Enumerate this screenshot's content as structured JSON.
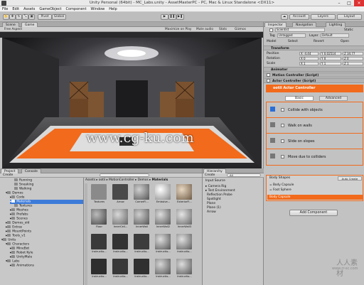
{
  "window": {
    "title": "Unity Personal (64bit) - MC_Labs.unity - AssetMasterPC - PC, Mac & Linux Standalone <DX11>"
  },
  "menu": [
    "File",
    "Edit",
    "Assets",
    "GameObject",
    "Component",
    "Window",
    "Help"
  ],
  "toolbar": {
    "pivot": "Pivot",
    "global": "Global",
    "account": "Account",
    "layers": "Layers",
    "layout": "Layout"
  },
  "game_tabs": {
    "scene": "Scene",
    "game": "Game"
  },
  "gamebar": {
    "aspect": "Free Aspect",
    "maximize": "Maximize on Play",
    "mute": "Mute audio",
    "stats": "Stats",
    "gizmos": "Gizmos"
  },
  "watermark": {
    "main": "www.cg-ku.com",
    "corner": "人人素材",
    "corner_url": "www.rr-sc.com"
  },
  "inspector": {
    "tabs": [
      "Inspector",
      "Navigation",
      "Lighting"
    ],
    "object_name": "Scientist",
    "static": "Static",
    "tag_label": "Tag",
    "tag_value": "Untagged",
    "layer_label": "Layer",
    "layer_value": "Default",
    "prefab": {
      "model": "Model",
      "select": "Select",
      "revert": "Revert",
      "open": "Open"
    },
    "transform": {
      "title": "Transform",
      "position": {
        "label": "Position",
        "x": "X -4.44",
        "y": "Y 0.02514",
        "z": "Z 34.77"
      },
      "rotation": {
        "label": "Rotation",
        "x": "X 0",
        "y": "Y 0",
        "z": "Z 0"
      },
      "scale": {
        "label": "Scale",
        "x": "X 1",
        "y": "Y 1",
        "z": "Z 1"
      }
    },
    "components": [
      "Animator",
      "Motion Controller (Script)",
      "Actor Controller (Script)"
    ],
    "actor_controller": "ootii Actor Controller",
    "sub_tabs": [
      "Basic",
      "Advanced"
    ],
    "options": [
      {
        "label": "Collide with objects",
        "checked": true
      },
      {
        "label": "Walk on walls",
        "checked": false
      },
      {
        "label": "Slide on slopes",
        "checked": false
      },
      {
        "label": "Move due to colliders",
        "checked": false
      }
    ],
    "body_shapes": {
      "title": "Body Shapes",
      "auto_create": "Auto Create",
      "items": [
        "Body Capsule",
        "Foot Sphere"
      ],
      "selected": "Body Capsule"
    },
    "add_component": "Add Component"
  },
  "project": {
    "tabs": [
      "Project",
      "Console"
    ],
    "create": "Create",
    "tree": [
      "Running",
      "Sneaking",
      "Walking",
      "Demos",
      "Code",
      "Materials",
      "Textures",
      "Meshes",
      "Prefabs",
      "Scenes",
      "Demos_old",
      "Extras",
      "MountPoints",
      "Tools_v1",
      "Units",
      "Characters",
      "MineBot",
      "Robot Kyle",
      "UnityMale",
      "Labs",
      "Animations"
    ],
    "breadcrumb": [
      "Assets",
      "ootii",
      "MotionController",
      "Demos",
      "Materials"
    ],
    "assets": [
      "Textures",
      "Arrow",
      "CornerFl...",
      "Emissive...",
      "ExteriorFl...",
      "Floor",
      "InnerCeil...",
      "InnerWall",
      "InnerWall2",
      "InnerWall3",
      "Instructio...",
      "Instructio...",
      "Instructio...",
      "Instructio...",
      "Instructio...",
      "Instructio...",
      "Instructio...",
      "Instructio...",
      "Instructio...",
      "Instructio..."
    ]
  },
  "hierarchy": {
    "tab": "Hierarchy",
    "create": "Create",
    "search": "All",
    "items": [
      "Input Source",
      "Camera Rig",
      "Test Environment",
      "Reflection Probe",
      "Spotlight",
      "Plane",
      "Plane (1)",
      "Arrow"
    ]
  },
  "colors": {
    "accent": "#f26a1b",
    "selection": "#3d7bd9"
  }
}
